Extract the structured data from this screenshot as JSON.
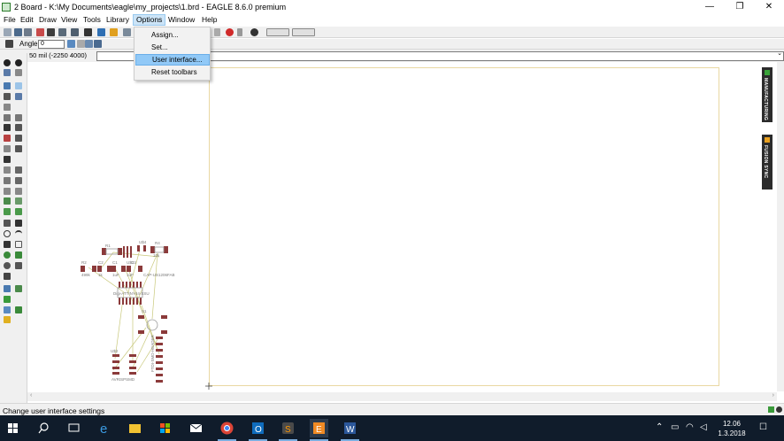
{
  "window": {
    "title": "2 Board - K:\\My Documents\\eagle\\my_projects\\1.brd - EAGLE 8.6.0 premium",
    "minimize_glyph": "—",
    "restore_glyph": "❐",
    "close_glyph": "✕"
  },
  "menubar": {
    "items": [
      "File",
      "Edit",
      "Draw",
      "View",
      "Tools",
      "Library",
      "Options",
      "Window",
      "Help"
    ]
  },
  "options_menu": {
    "items": [
      "Assign...",
      "Set...",
      "User interface...",
      "Reset toolbars"
    ],
    "highlighted": "User interface..."
  },
  "toolbar2": {
    "angle_label": "Angle:",
    "angle_value": "0"
  },
  "command_bar": {
    "coordinate": "50 mil (-2250 4000)",
    "command_value": ""
  },
  "board_parts": {
    "labels": [
      "R1",
      "U$4",
      "R4",
      "R2",
      "C2",
      "C1",
      "U$3",
      "C3",
      "499k",
      "1k",
      "10k",
      "1uF",
      "1uF",
      "CAP-US1206FAB",
      "Digi-ATTINY44-SSU",
      "S1",
      "U$2",
      "AVRISPSMD",
      "FTDI-SMD-HEADER"
    ]
  },
  "right_panel": {
    "tabs": [
      "MANUFACTURING",
      "FUSION SYNC"
    ]
  },
  "statusbar": {
    "message": "Change user interface settings"
  },
  "taskbar": {
    "clock_time": "12.06",
    "clock_date": "1.3.2018"
  },
  "colors": {
    "menu_active": "#cce4f7",
    "menu_highlight": "#91c9f7",
    "pad_color": "#8b3a3a",
    "airwire_color": "#c8c87a",
    "taskbar_bg": "#101c2b"
  }
}
